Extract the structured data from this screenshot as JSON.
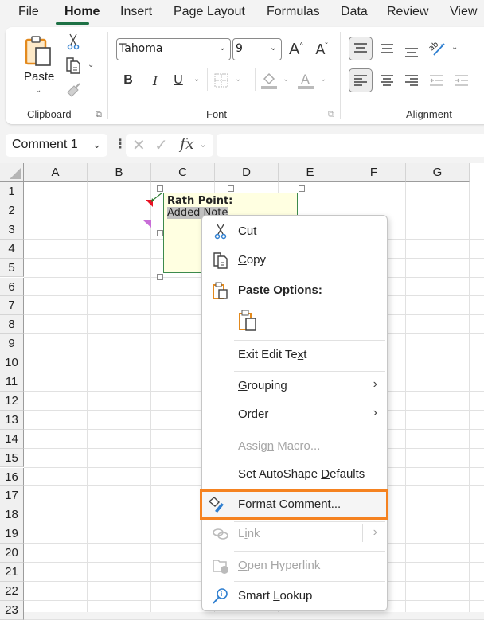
{
  "menu_tabs": [
    "File",
    "Home",
    "Insert",
    "Page Layout",
    "Formulas",
    "Data",
    "Review",
    "View"
  ],
  "active_tab": "Home",
  "ribbon": {
    "clipboard": {
      "label": "Clipboard",
      "paste_label": "Paste"
    },
    "font": {
      "label": "Font",
      "font_name": "Tahoma",
      "font_size": "9",
      "bold": "B",
      "italic": "I",
      "underline": "U"
    },
    "alignment": {
      "label": "Alignment"
    }
  },
  "formula_bar": {
    "name_box": "Comment 1",
    "fx": "fx",
    "formula": ""
  },
  "columns": [
    "A",
    "B",
    "C",
    "D",
    "E",
    "F",
    "G"
  ],
  "rows": [
    "1",
    "2",
    "3",
    "4",
    "5",
    "6",
    "7",
    "8",
    "9",
    "10",
    "11",
    "12",
    "13",
    "14",
    "15",
    "16",
    "17",
    "18",
    "19",
    "20",
    "21",
    "22",
    "23"
  ],
  "comment": {
    "author": "Rath Point:",
    "text": "Added Note"
  },
  "context_menu": {
    "items": [
      {
        "label": "Cut",
        "icon": "scissors-icon",
        "underline": "t",
        "enabled": true
      },
      {
        "label": "Copy",
        "icon": "copy-icon",
        "underline": "C",
        "enabled": true
      },
      {
        "label": "Paste Options:",
        "icon": "paste-icon",
        "enabled": true,
        "header": true
      },
      {
        "label": "Exit Edit Text",
        "underline": "x",
        "enabled": true
      },
      {
        "label": "Grouping",
        "underline": "G",
        "enabled": true,
        "submenu": true
      },
      {
        "label": "Order",
        "underline": "r",
        "enabled": true,
        "submenu": true
      },
      {
        "label": "Assign Macro...",
        "underline": "n",
        "enabled": false
      },
      {
        "label": "Set AutoShape Defaults",
        "underline": "D",
        "enabled": true
      },
      {
        "label": "Format Comment...",
        "icon": "format-comment-icon",
        "underline": "o",
        "enabled": true,
        "highlighted": true
      },
      {
        "label": "Link",
        "icon": "link-icon",
        "underline": "i",
        "enabled": false,
        "submenu": true
      },
      {
        "label": "Open Hyperlink",
        "icon": "open-hyperlink-icon",
        "underline": "O",
        "enabled": false
      },
      {
        "label": "Smart Lookup",
        "icon": "smart-lookup-icon",
        "underline": "L",
        "enabled": true
      }
    ]
  },
  "colors": {
    "accent_green": "#1e7145",
    "highlight_orange": "#f58220",
    "comment_bg": "#ffffe1"
  }
}
